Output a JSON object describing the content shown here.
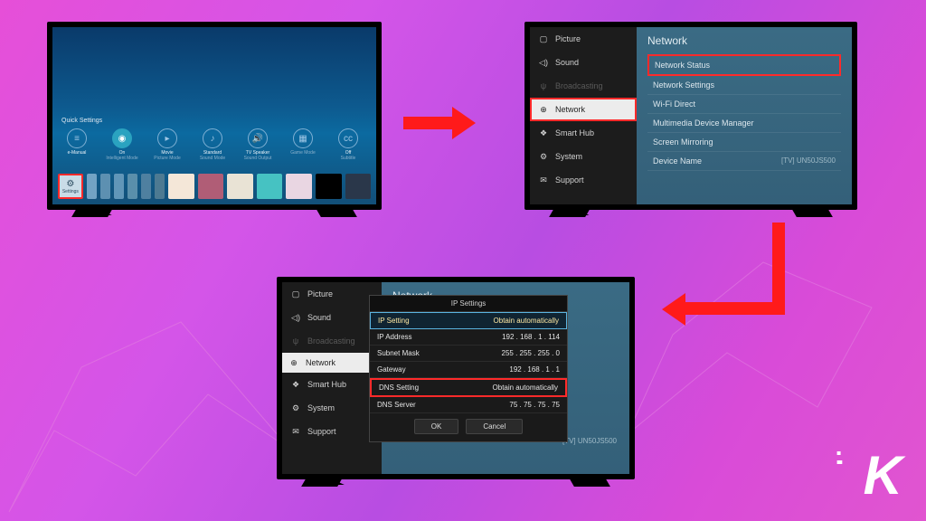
{
  "tv1": {
    "quick_settings_label": "Quick Settings",
    "items": [
      {
        "t1": "e-Manual",
        "t2": ""
      },
      {
        "t1": "On",
        "t2": "Intelligent Mode"
      },
      {
        "t1": "Movie",
        "t2": "Picture Mode"
      },
      {
        "t1": "Standard",
        "t2": "Sound Mode"
      },
      {
        "t1": "TV Speaker",
        "t2": "Sound Output"
      },
      {
        "t1": "",
        "t2": "Game Mode"
      },
      {
        "t1": "Off",
        "t2": "Subtitle"
      }
    ],
    "settings_tile": "Settings"
  },
  "tv2": {
    "sidebar": [
      {
        "label": "Picture"
      },
      {
        "label": "Sound"
      },
      {
        "label": "Broadcasting"
      },
      {
        "label": "Network"
      },
      {
        "label": "Smart Hub"
      },
      {
        "label": "System"
      },
      {
        "label": "Support"
      }
    ],
    "panel_title": "Network",
    "options": [
      "Network Status",
      "Network Settings",
      "Wi-Fi Direct",
      "Multimedia Device Manager",
      "Screen Mirroring"
    ],
    "device_row": {
      "label": "Device Name",
      "value": "[TV] UN50JS500"
    }
  },
  "tv3": {
    "sidebar": [
      {
        "label": "Picture"
      },
      {
        "label": "Sound"
      },
      {
        "label": "Broadcasting"
      },
      {
        "label": "Network"
      },
      {
        "label": "Smart Hub"
      },
      {
        "label": "System"
      },
      {
        "label": "Support"
      }
    ],
    "panel_title": "Network",
    "device_value": "[TV] UN50JS500",
    "dialog": {
      "title": "IP Settings",
      "rows": [
        {
          "k": "IP Setting",
          "v": "Obtain automatically"
        },
        {
          "k": "IP Address",
          "v": "192 . 168 . 1 . 114"
        },
        {
          "k": "Subnet Mask",
          "v": "255 . 255 . 255 . 0"
        },
        {
          "k": "Gateway",
          "v": "192 . 168 . 1 . 1"
        },
        {
          "k": "DNS Setting",
          "v": "Obtain automatically"
        },
        {
          "k": "DNS Server",
          "v": "75 . 75 . 75 . 75"
        }
      ],
      "ok": "OK",
      "cancel": "Cancel"
    }
  },
  "logo": "K"
}
